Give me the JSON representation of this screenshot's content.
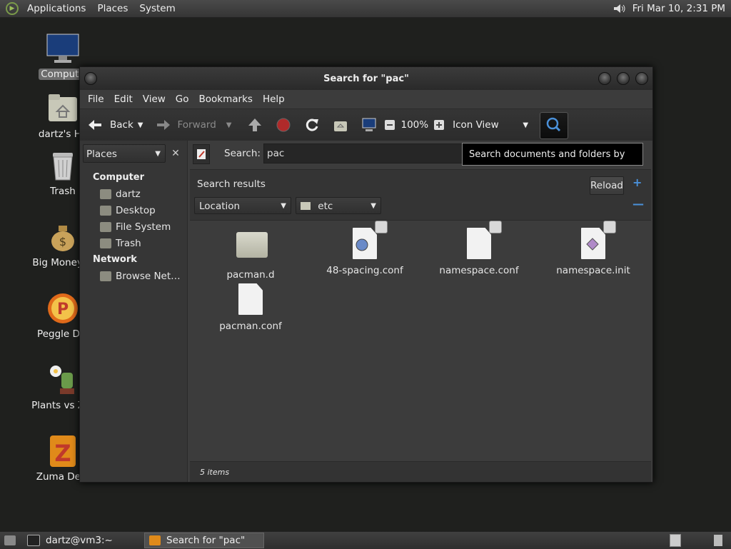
{
  "top_panel": {
    "menus": [
      "Applications",
      "Places",
      "System"
    ],
    "clock": "Fri Mar 10,  2:31 PM"
  },
  "desktop_icons": [
    {
      "label": "Compute",
      "icon": "computer-icon"
    },
    {
      "label": "dartz's Ho",
      "icon": "home-folder-icon"
    },
    {
      "label": "Trash",
      "icon": "trash-icon"
    },
    {
      "label": "Big Money D",
      "icon": "money-bag-icon"
    },
    {
      "label": "Peggle Del",
      "icon": "peggle-icon"
    },
    {
      "label": "Plants vs Zor",
      "icon": "plants-icon"
    },
    {
      "label": "Zuma Delu",
      "icon": "zuma-icon"
    }
  ],
  "window": {
    "title": "Search for \"pac\"",
    "menu": [
      "File",
      "Edit",
      "View",
      "Go",
      "Bookmarks",
      "Help"
    ],
    "toolbar": {
      "back": "Back",
      "forward": "Forward",
      "zoom": "100%",
      "view_mode": "Icon View"
    },
    "side": {
      "combo": "Places",
      "sections": [
        {
          "title": "Computer",
          "items": [
            "dartz",
            "Desktop",
            "File System",
            "Trash"
          ]
        },
        {
          "title": "Network",
          "items": [
            "Browse Net…"
          ]
        }
      ]
    },
    "search": {
      "label": "Search:",
      "value": "pac",
      "tooltip": "Search documents and folders by name"
    },
    "results": {
      "title": "Search results",
      "reload": "Reload",
      "criterion": "Location",
      "location_value": "etc"
    },
    "files": [
      {
        "name": "pacman.d",
        "type": "folder"
      },
      {
        "name": "48-spacing.conf",
        "type": "doc-special"
      },
      {
        "name": "namespace.conf",
        "type": "doc"
      },
      {
        "name": "namespace.init",
        "type": "doc-special"
      },
      {
        "name": "pacman.conf",
        "type": "doc"
      }
    ],
    "status": "5 items"
  },
  "bottom_panel": {
    "tasks": [
      "dartz@vm3:~",
      "Search for \"pac\""
    ]
  },
  "colors": {
    "accent": "#4a90d9",
    "stop": "#c0392b"
  }
}
